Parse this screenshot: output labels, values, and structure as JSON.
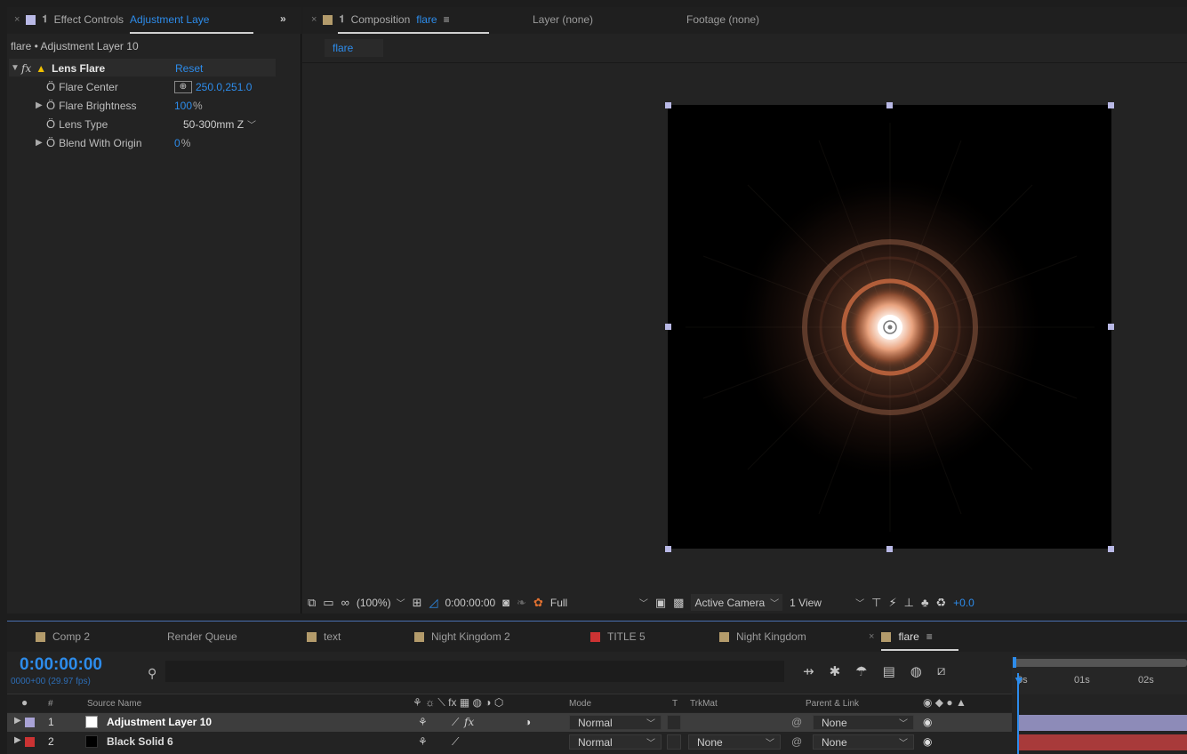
{
  "effect_controls": {
    "tab_title": "Effect Controls",
    "tab_layer": "Adjustment Laye",
    "more": "»",
    "breadcrumb": "flare • Adjustment Layer 10",
    "effect_name": "Lens Flare",
    "reset": "Reset",
    "props": [
      {
        "label": "Flare Center",
        "value": "250.0,251.0"
      },
      {
        "label": "Flare Brightness",
        "value": "100",
        "unit": "%"
      },
      {
        "label": "Lens Type",
        "value": "50-300mm Z"
      },
      {
        "label": "Blend With Origin",
        "value": "0",
        "unit": "%"
      }
    ]
  },
  "composition": {
    "tab_title": "Composition",
    "tab_comp": "flare",
    "layer_tab": "Layer (none)",
    "footage_tab": "Footage (none)",
    "crumb": "flare",
    "toolbar": {
      "zoom": "(100%)",
      "time": "0:00:00:00",
      "resolution": "Full",
      "camera": "Active Camera",
      "views": "1 View",
      "exposure": "+0.0"
    }
  },
  "timeline": {
    "tabs": [
      {
        "label": "Comp 2",
        "color": "#b39b6b"
      },
      {
        "label": "Render Queue",
        "color": ""
      },
      {
        "label": "text",
        "color": "#b39b6b"
      },
      {
        "label": "Night Kingdom 2",
        "color": "#b39b6b"
      },
      {
        "label": "TITLE 5",
        "color": "#c33"
      },
      {
        "label": "Night Kingdom",
        "color": "#b39b6b"
      },
      {
        "label": "flare",
        "color": "#b39b6b"
      }
    ],
    "timecode": "0:00:00:00",
    "fps": "0000+00 (29.97 fps)",
    "ruler": [
      "0s",
      "01s",
      "02s"
    ],
    "columns": {
      "num": "#",
      "source": "Source Name",
      "mode": "Mode",
      "t": "T",
      "trkmat": "TrkMat",
      "parent": "Parent & Link"
    },
    "layers": [
      {
        "num": "1",
        "name": "Adjustment Layer 10",
        "mode": "Normal",
        "trkmat": "",
        "parent": "None",
        "label_color": "#a9a3d6",
        "swatch": "#ffffff"
      },
      {
        "num": "2",
        "name": "Black Solid 6",
        "mode": "Normal",
        "trkmat": "None",
        "parent": "None",
        "label_color": "#c33",
        "swatch": "#000000"
      }
    ]
  },
  "colors": {
    "accent": "#2d8ceb",
    "panel": "#232323"
  }
}
